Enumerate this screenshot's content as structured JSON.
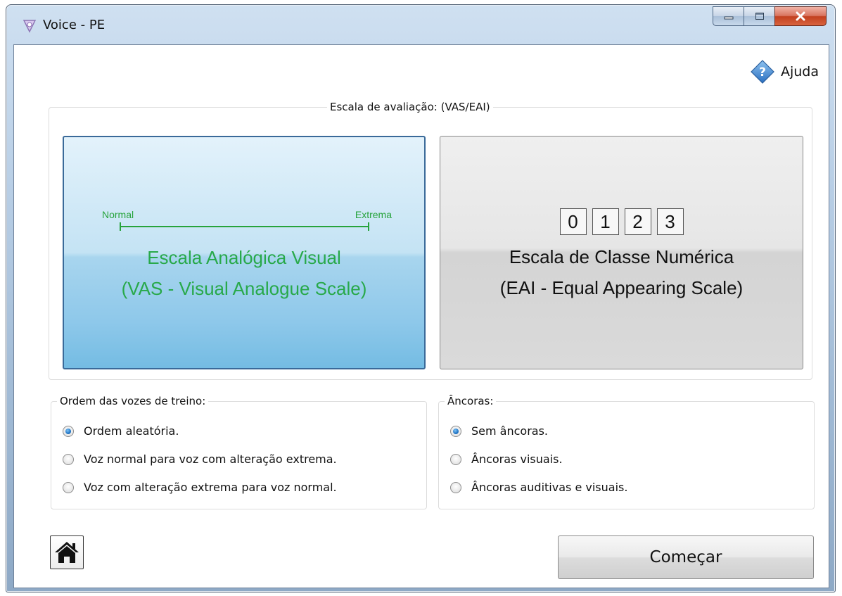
{
  "window": {
    "title": "Voice - PE",
    "icon": "voice-app-icon",
    "controls": [
      "minimize-icon",
      "maximize-icon",
      "close-icon"
    ]
  },
  "help": {
    "label": "Ajuda",
    "icon": "help-diamond-icon"
  },
  "scale_group": {
    "legend": "Escala de avaliação: (VAS/EAI)",
    "vas": {
      "normal_label": "Normal",
      "extrema_label": "Extrema",
      "title_line1": "Escala Analógica Visual",
      "title_line2": "(VAS - Visual Analogue Scale)",
      "selected": true
    },
    "eai": {
      "digits": [
        "0",
        "1",
        "2",
        "3"
      ],
      "title_line1": "Escala de Classe Numérica",
      "title_line2": "(EAI - Equal Appearing Scale)",
      "selected": false
    }
  },
  "order_group": {
    "legend": "Ordem das vozes de treino:",
    "options": [
      {
        "label": "Ordem aleatória.",
        "checked": true
      },
      {
        "label": "Voz normal para voz com alteração extrema.",
        "checked": false
      },
      {
        "label": "Voz com alteração extrema para voz normal.",
        "checked": false
      }
    ]
  },
  "anchor_group": {
    "legend": "Âncoras:",
    "options": [
      {
        "label": "Sem âncoras.",
        "checked": true
      },
      {
        "label": "Âncoras visuais.",
        "checked": false
      },
      {
        "label": "Âncoras auditivas e visuais.",
        "checked": false
      }
    ]
  },
  "footer": {
    "home_icon": "home-icon",
    "start_label": "Começar"
  },
  "colors": {
    "vas_green": "#28a94a",
    "vas_card_border": "#3a6a99",
    "radio_selected": "#1f74c5"
  }
}
